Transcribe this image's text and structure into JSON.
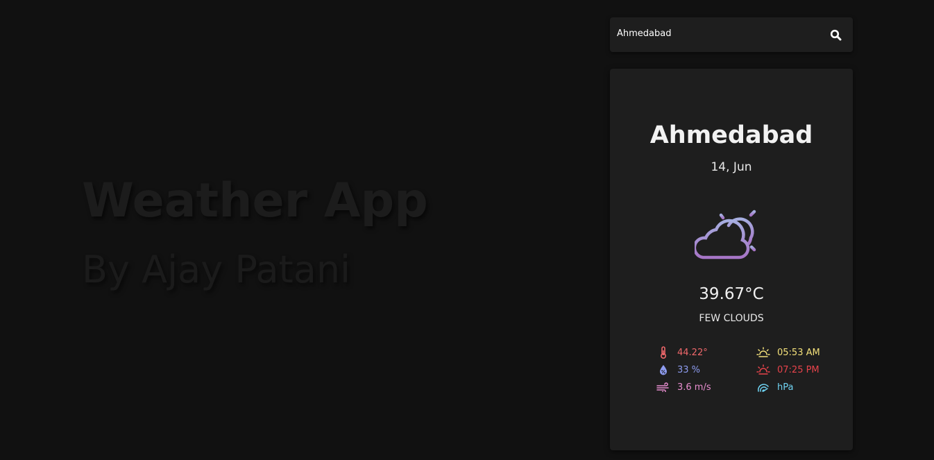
{
  "hero": {
    "title": "Weather App",
    "subtitle": "By Ajay Patani"
  },
  "search": {
    "value": "Ahmedabad",
    "icon": "search-icon"
  },
  "weather": {
    "city": "Ahmedabad",
    "date": "14, Jun",
    "icon": "partly-cloudy-icon",
    "temperature": "39.67°C",
    "description": "few clouds",
    "stats": {
      "feels_like": "44.22°",
      "humidity": "33 %",
      "wind": "3.6 m/s",
      "sunrise": "05:53 AM",
      "sunset": "07:25 PM",
      "pressure": "hPa"
    }
  },
  "colors": {
    "background": "#111111",
    "card": "#1e1e1e",
    "feels_like": "#f0686b",
    "humidity": "#8e9cf0",
    "wind": "#e98ed0",
    "sunrise": "#f3e07a",
    "sunset": "#e8434b",
    "pressure": "#6fd3f2",
    "icon_gradient_top": "#a0a4dc",
    "icon_gradient_bottom": "#a977c8"
  }
}
